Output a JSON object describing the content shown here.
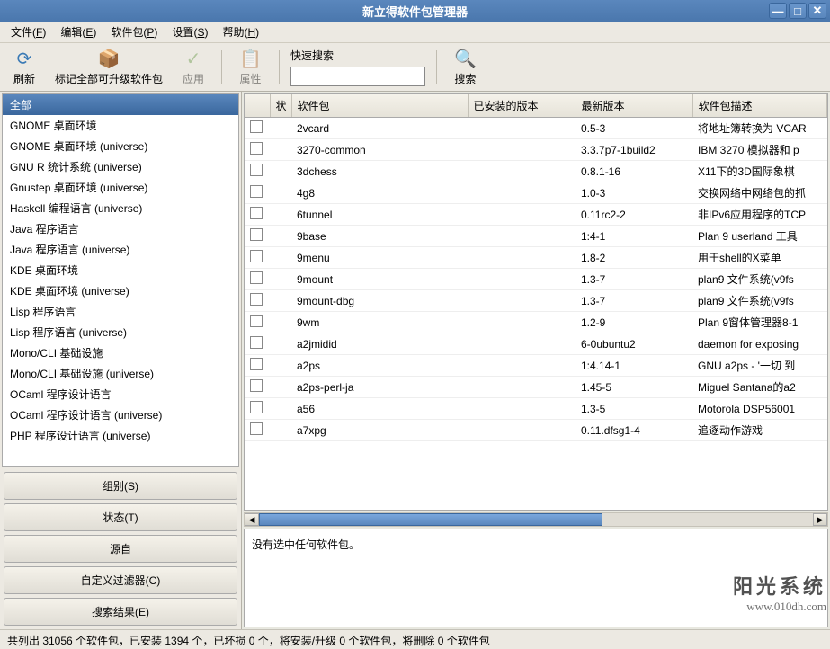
{
  "window": {
    "title": "新立得软件包管理器"
  },
  "menubar": [
    {
      "label": "文件",
      "key": "F"
    },
    {
      "label": "编辑",
      "key": "E"
    },
    {
      "label": "软件包",
      "key": "P"
    },
    {
      "label": "设置",
      "key": "S"
    },
    {
      "label": "帮助",
      "key": "H"
    }
  ],
  "toolbar": {
    "reload": "刷新",
    "markall": "标记全部可升级软件包",
    "apply": "应用",
    "properties": "属性",
    "qsearch_label": "快速搜索",
    "qsearch_value": "",
    "search": "搜索"
  },
  "categories": [
    "全部",
    "GNOME 桌面环境",
    "GNOME 桌面环境 (universe)",
    "GNU R 统计系统 (universe)",
    "Gnustep 桌面环境 (universe)",
    "Haskell 编程语言 (universe)",
    "Java 程序语言",
    "Java 程序语言 (universe)",
    "KDE 桌面环境",
    "KDE 桌面环境 (universe)",
    "Lisp 程序语言",
    "Lisp 程序语言 (universe)",
    "Mono/CLI 基础设施",
    "Mono/CLI 基础设施 (universe)",
    "OCaml 程序设计语言",
    "OCaml 程序设计语言 (universe)",
    "PHP 程序设计语言 (universe)"
  ],
  "filter_buttons": {
    "sections": "组别(S)",
    "status": "状态(T)",
    "origin": "源自",
    "custom": "自定义过滤器(C)",
    "search_results": "搜索结果(E)"
  },
  "table": {
    "headers": {
      "status": "状",
      "package": "软件包",
      "installed": "已安装的版本",
      "latest": "最新版本",
      "description": "软件包描述"
    },
    "rows": [
      {
        "pkg": "2vcard",
        "inst": "",
        "latest": "0.5-3",
        "desc": "将地址簿转换为 VCAR"
      },
      {
        "pkg": "3270-common",
        "inst": "",
        "latest": "3.3.7p7-1build2",
        "desc": "IBM 3270 模拟器和 p"
      },
      {
        "pkg": "3dchess",
        "inst": "",
        "latest": "0.8.1-16",
        "desc": "X11下的3D国际象棋"
      },
      {
        "pkg": "4g8",
        "inst": "",
        "latest": "1.0-3",
        "desc": "交换网络中网络包的抓"
      },
      {
        "pkg": "6tunnel",
        "inst": "",
        "latest": "0.11rc2-2",
        "desc": "非IPv6应用程序的TCP"
      },
      {
        "pkg": "9base",
        "inst": "",
        "latest": "1:4-1",
        "desc": "Plan 9 userland 工具"
      },
      {
        "pkg": "9menu",
        "inst": "",
        "latest": "1.8-2",
        "desc": "用于shell的X菜单"
      },
      {
        "pkg": "9mount",
        "inst": "",
        "latest": "1.3-7",
        "desc": "plan9 文件系统(v9fs"
      },
      {
        "pkg": "9mount-dbg",
        "inst": "",
        "latest": "1.3-7",
        "desc": "plan9 文件系统(v9fs"
      },
      {
        "pkg": "9wm",
        "inst": "",
        "latest": "1.2-9",
        "desc": "Plan 9窗体管理器8-1"
      },
      {
        "pkg": "a2jmidid",
        "inst": "",
        "latest": "6-0ubuntu2",
        "desc": "daemon for exposing"
      },
      {
        "pkg": "a2ps",
        "inst": "",
        "latest": "1:4.14-1",
        "desc": "GNU a2ps - '一切 到"
      },
      {
        "pkg": "a2ps-perl-ja",
        "inst": "",
        "latest": "1.45-5",
        "desc": "Miguel Santana的a2"
      },
      {
        "pkg": "a56",
        "inst": "",
        "latest": "1.3-5",
        "desc": "Motorola DSP56001"
      },
      {
        "pkg": "a7xpg",
        "inst": "",
        "latest": "0.11.dfsg1-4",
        "desc": "追逐动作游戏"
      }
    ]
  },
  "description_panel": "没有选中任何软件包。",
  "statusbar": "共列出 31056 个软件包，已安装 1394 个，已坏损 0 个，将安装/升级 0 个软件包，将删除 0 个软件包",
  "watermark": {
    "line1": "阳光系统",
    "line2": "www.010dh.com"
  }
}
